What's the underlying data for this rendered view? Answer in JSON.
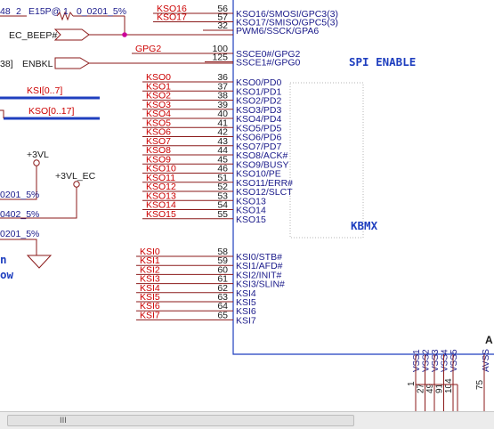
{
  "colors": {
    "bus": "#1f3fbf",
    "wire": "#8b1a1a",
    "netlabel": "#cc0000",
    "chip": "#1f3fbf",
    "text": "#1a1a8a"
  },
  "top_fragment": {
    "res_text": "48",
    "left_num": "2",
    "part": "E15P@",
    "right_num": "1",
    "pkg": "0_0201_5%"
  },
  "left_labels": {
    "ec_beep": "EC_BEEP#",
    "enbkl_ref": "38]",
    "enbkl": "ENBKL",
    "ksi_bus": "KSI[0..7]",
    "kso_bus": "KSO[0..17]",
    "p3vl": "+3VL",
    "p3vl_ec": "+3VL_EC",
    "r1": "0201_5%",
    "r2": "0402_5%",
    "r3": "0201_5%",
    "frag_n": "n",
    "frag_ow": "ow"
  },
  "ksx_nets": [
    {
      "net": "KSO16",
      "pin": "56",
      "name": "KSO16/SMOSI/GPC3(3)"
    },
    {
      "net": "KSO17",
      "pin": "57",
      "name": "KSO17/SMISO/GPC5(3)"
    },
    {
      "net": "",
      "pin": "32",
      "name": "PWM6/SSCK/GPA6"
    }
  ],
  "gpg_nets": [
    {
      "net": "GPG2",
      "pin": "100",
      "name": "SSCE0#/GPG2"
    },
    {
      "net": "",
      "pin": "125",
      "name": "SSCE1#/GPG0"
    }
  ],
  "kso_nets": [
    {
      "net": "KSO0",
      "pin": "36",
      "name": "KSO0/PD0"
    },
    {
      "net": "KSO1",
      "pin": "37",
      "name": "KSO1/PD1"
    },
    {
      "net": "KSO2",
      "pin": "38",
      "name": "KSO2/PD2"
    },
    {
      "net": "KSO3",
      "pin": "39",
      "name": "KSO3/PD3"
    },
    {
      "net": "KSO4",
      "pin": "40",
      "name": "KSO4/PD4"
    },
    {
      "net": "KSO5",
      "pin": "41",
      "name": "KSO5/PD5"
    },
    {
      "net": "KSO6",
      "pin": "42",
      "name": "KSO6/PD6"
    },
    {
      "net": "KSO7",
      "pin": "43",
      "name": "KSO7/PD7"
    },
    {
      "net": "KSO8",
      "pin": "44",
      "name": "KSO8/ACK#"
    },
    {
      "net": "KSO9",
      "pin": "45",
      "name": "KSO9/BUSY"
    },
    {
      "net": "KSO10",
      "pin": "46",
      "name": "KSO10/PE"
    },
    {
      "net": "KSO11",
      "pin": "51",
      "name": "KSO11/ERR#"
    },
    {
      "net": "KSO12",
      "pin": "52",
      "name": "KSO12/SLCT"
    },
    {
      "net": "KSO13",
      "pin": "53",
      "name": "KSO13"
    },
    {
      "net": "KSO14",
      "pin": "54",
      "name": "KSO14"
    },
    {
      "net": "KSO15",
      "pin": "55",
      "name": "KSO15"
    }
  ],
  "ksi_nets": [
    {
      "net": "KSI0",
      "pin": "58",
      "name": "KSI0/STB#"
    },
    {
      "net": "KSI1",
      "pin": "59",
      "name": "KSI1/AFD#"
    },
    {
      "net": "KSI2",
      "pin": "60",
      "name": "KSI2/INIT#"
    },
    {
      "net": "KSI3",
      "pin": "61",
      "name": "KSI3/SLIN#"
    },
    {
      "net": "KSI4",
      "pin": "62",
      "name": "KSI4"
    },
    {
      "net": "KSI5",
      "pin": "63",
      "name": "KSI5"
    },
    {
      "net": "KSI6",
      "pin": "64",
      "name": "KSI6"
    },
    {
      "net": "KSI7",
      "pin": "65",
      "name": "KSI7"
    }
  ],
  "section_titles": {
    "spi": "SPI ENABLE",
    "kbmx": "KBMX"
  },
  "bottom_pins": [
    {
      "name": "VSS1",
      "num": "1"
    },
    {
      "name": "VSS2",
      "num": "27"
    },
    {
      "name": "VSS3",
      "num": "49"
    },
    {
      "name": "VSS4",
      "num": "91"
    },
    {
      "name": "VSS5",
      "num": "104"
    }
  ],
  "avss": {
    "name": "AVSS",
    "num": "75"
  },
  "corner_text": "A",
  "scrollbar": {
    "grip": "III"
  }
}
